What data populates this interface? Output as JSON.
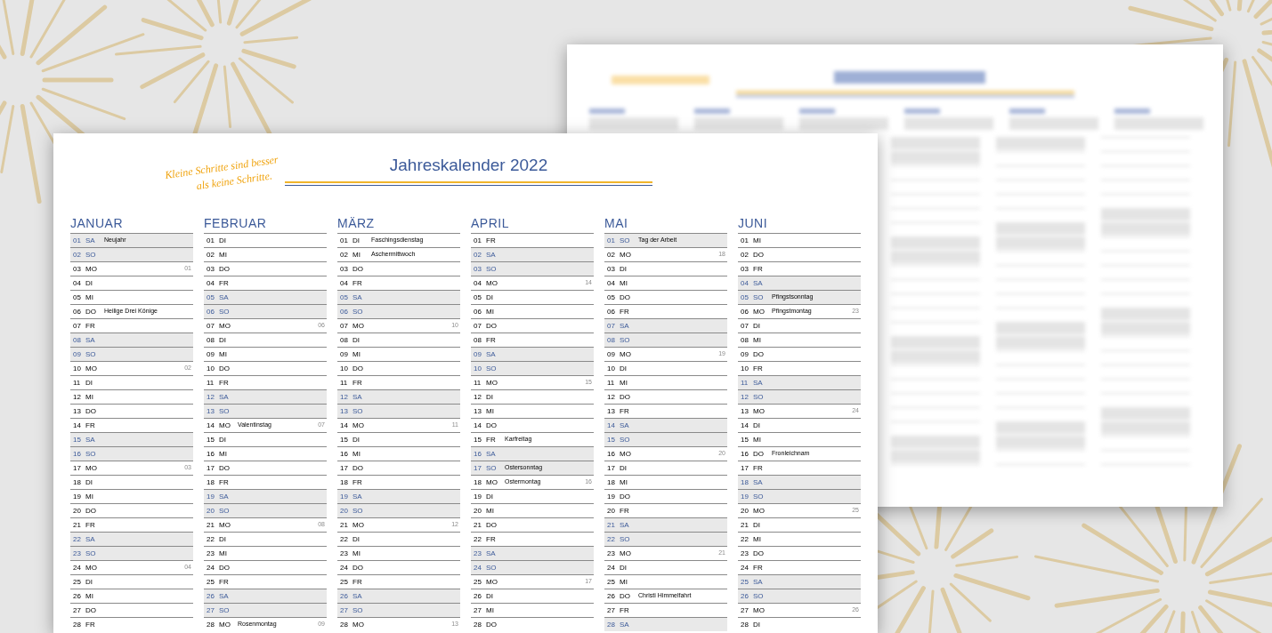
{
  "sheet": {
    "slogan": [
      "Kleine Schritte sind besser",
      "als keine Schritte."
    ],
    "title": "Jahreskalender 2022"
  },
  "months": [
    {
      "name": "JANUAR",
      "days": [
        {
          "date": "01",
          "weekday": "SA",
          "weekend": true,
          "note": "Neujahr"
        },
        {
          "date": "02",
          "weekday": "SO",
          "weekend": true
        },
        {
          "date": "03",
          "weekday": "MO",
          "weekend": false,
          "week": "01"
        },
        {
          "date": "04",
          "weekday": "DI",
          "weekend": false
        },
        {
          "date": "05",
          "weekday": "MI",
          "weekend": false
        },
        {
          "date": "06",
          "weekday": "DO",
          "weekend": false,
          "note": "Heilige Drei Könige"
        },
        {
          "date": "07",
          "weekday": "FR",
          "weekend": false
        },
        {
          "date": "08",
          "weekday": "SA",
          "weekend": true
        },
        {
          "date": "09",
          "weekday": "SO",
          "weekend": true
        },
        {
          "date": "10",
          "weekday": "MO",
          "weekend": false,
          "week": "02"
        },
        {
          "date": "11",
          "weekday": "DI",
          "weekend": false
        },
        {
          "date": "12",
          "weekday": "MI",
          "weekend": false
        },
        {
          "date": "13",
          "weekday": "DO",
          "weekend": false
        },
        {
          "date": "14",
          "weekday": "FR",
          "weekend": false
        },
        {
          "date": "15",
          "weekday": "SA",
          "weekend": true
        },
        {
          "date": "16",
          "weekday": "SO",
          "weekend": true
        },
        {
          "date": "17",
          "weekday": "MO",
          "weekend": false,
          "week": "03"
        },
        {
          "date": "18",
          "weekday": "DI",
          "weekend": false
        },
        {
          "date": "19",
          "weekday": "MI",
          "weekend": false
        },
        {
          "date": "20",
          "weekday": "DO",
          "weekend": false
        },
        {
          "date": "21",
          "weekday": "FR",
          "weekend": false
        },
        {
          "date": "22",
          "weekday": "SA",
          "weekend": true
        },
        {
          "date": "23",
          "weekday": "SO",
          "weekend": true
        },
        {
          "date": "24",
          "weekday": "MO",
          "weekend": false,
          "week": "04"
        },
        {
          "date": "25",
          "weekday": "DI",
          "weekend": false
        },
        {
          "date": "26",
          "weekday": "MI",
          "weekend": false
        },
        {
          "date": "27",
          "weekday": "DO",
          "weekend": false
        },
        {
          "date": "28",
          "weekday": "FR",
          "weekend": false
        }
      ]
    },
    {
      "name": "FEBRUAR",
      "days": [
        {
          "date": "01",
          "weekday": "DI",
          "weekend": false
        },
        {
          "date": "02",
          "weekday": "MI",
          "weekend": false
        },
        {
          "date": "03",
          "weekday": "DO",
          "weekend": false
        },
        {
          "date": "04",
          "weekday": "FR",
          "weekend": false
        },
        {
          "date": "05",
          "weekday": "SA",
          "weekend": true
        },
        {
          "date": "06",
          "weekday": "SO",
          "weekend": true
        },
        {
          "date": "07",
          "weekday": "MO",
          "weekend": false,
          "week": "06"
        },
        {
          "date": "08",
          "weekday": "DI",
          "weekend": false
        },
        {
          "date": "09",
          "weekday": "MI",
          "weekend": false
        },
        {
          "date": "10",
          "weekday": "DO",
          "weekend": false
        },
        {
          "date": "11",
          "weekday": "FR",
          "weekend": false
        },
        {
          "date": "12",
          "weekday": "SA",
          "weekend": true
        },
        {
          "date": "13",
          "weekday": "SO",
          "weekend": true
        },
        {
          "date": "14",
          "weekday": "MO",
          "weekend": false,
          "note": "Valentinstag",
          "week": "07"
        },
        {
          "date": "15",
          "weekday": "DI",
          "weekend": false
        },
        {
          "date": "16",
          "weekday": "MI",
          "weekend": false
        },
        {
          "date": "17",
          "weekday": "DO",
          "weekend": false
        },
        {
          "date": "18",
          "weekday": "FR",
          "weekend": false
        },
        {
          "date": "19",
          "weekday": "SA",
          "weekend": true
        },
        {
          "date": "20",
          "weekday": "SO",
          "weekend": true
        },
        {
          "date": "21",
          "weekday": "MO",
          "weekend": false,
          "week": "08"
        },
        {
          "date": "22",
          "weekday": "DI",
          "weekend": false
        },
        {
          "date": "23",
          "weekday": "MI",
          "weekend": false
        },
        {
          "date": "24",
          "weekday": "DO",
          "weekend": false
        },
        {
          "date": "25",
          "weekday": "FR",
          "weekend": false
        },
        {
          "date": "26",
          "weekday": "SA",
          "weekend": true
        },
        {
          "date": "27",
          "weekday": "SO",
          "weekend": true
        },
        {
          "date": "28",
          "weekday": "MO",
          "weekend": false,
          "note": "Rosenmontag",
          "week": "09"
        }
      ]
    },
    {
      "name": "MÄRZ",
      "days": [
        {
          "date": "01",
          "weekday": "DI",
          "weekend": false,
          "note": "Faschingsdienstag"
        },
        {
          "date": "02",
          "weekday": "MI",
          "weekend": false,
          "note": "Aschermittwoch"
        },
        {
          "date": "03",
          "weekday": "DO",
          "weekend": false
        },
        {
          "date": "04",
          "weekday": "FR",
          "weekend": false
        },
        {
          "date": "05",
          "weekday": "SA",
          "weekend": true
        },
        {
          "date": "06",
          "weekday": "SO",
          "weekend": true
        },
        {
          "date": "07",
          "weekday": "MO",
          "weekend": false,
          "week": "10"
        },
        {
          "date": "08",
          "weekday": "DI",
          "weekend": false
        },
        {
          "date": "09",
          "weekday": "MI",
          "weekend": false
        },
        {
          "date": "10",
          "weekday": "DO",
          "weekend": false
        },
        {
          "date": "11",
          "weekday": "FR",
          "weekend": false
        },
        {
          "date": "12",
          "weekday": "SA",
          "weekend": true
        },
        {
          "date": "13",
          "weekday": "SO",
          "weekend": true
        },
        {
          "date": "14",
          "weekday": "MO",
          "weekend": false,
          "week": "11"
        },
        {
          "date": "15",
          "weekday": "DI",
          "weekend": false
        },
        {
          "date": "16",
          "weekday": "MI",
          "weekend": false
        },
        {
          "date": "17",
          "weekday": "DO",
          "weekend": false
        },
        {
          "date": "18",
          "weekday": "FR",
          "weekend": false
        },
        {
          "date": "19",
          "weekday": "SA",
          "weekend": true
        },
        {
          "date": "20",
          "weekday": "SO",
          "weekend": true
        },
        {
          "date": "21",
          "weekday": "MO",
          "weekend": false,
          "week": "12"
        },
        {
          "date": "22",
          "weekday": "DI",
          "weekend": false
        },
        {
          "date": "23",
          "weekday": "MI",
          "weekend": false
        },
        {
          "date": "24",
          "weekday": "DO",
          "weekend": false
        },
        {
          "date": "25",
          "weekday": "FR",
          "weekend": false
        },
        {
          "date": "26",
          "weekday": "SA",
          "weekend": true
        },
        {
          "date": "27",
          "weekday": "SO",
          "weekend": true
        },
        {
          "date": "28",
          "weekday": "MO",
          "weekend": false,
          "week": "13"
        }
      ]
    },
    {
      "name": "APRIL",
      "days": [
        {
          "date": "01",
          "weekday": "FR",
          "weekend": false
        },
        {
          "date": "02",
          "weekday": "SA",
          "weekend": true
        },
        {
          "date": "03",
          "weekday": "SO",
          "weekend": true
        },
        {
          "date": "04",
          "weekday": "MO",
          "weekend": false,
          "week": "14"
        },
        {
          "date": "05",
          "weekday": "DI",
          "weekend": false
        },
        {
          "date": "06",
          "weekday": "MI",
          "weekend": false
        },
        {
          "date": "07",
          "weekday": "DO",
          "weekend": false
        },
        {
          "date": "08",
          "weekday": "FR",
          "weekend": false
        },
        {
          "date": "09",
          "weekday": "SA",
          "weekend": true
        },
        {
          "date": "10",
          "weekday": "SO",
          "weekend": true
        },
        {
          "date": "11",
          "weekday": "MO",
          "weekend": false,
          "week": "15"
        },
        {
          "date": "12",
          "weekday": "DI",
          "weekend": false
        },
        {
          "date": "13",
          "weekday": "MI",
          "weekend": false
        },
        {
          "date": "14",
          "weekday": "DO",
          "weekend": false
        },
        {
          "date": "15",
          "weekday": "FR",
          "weekend": false,
          "note": "Karfreitag"
        },
        {
          "date": "16",
          "weekday": "SA",
          "weekend": true
        },
        {
          "date": "17",
          "weekday": "SO",
          "weekend": true,
          "note": "Ostersonntag"
        },
        {
          "date": "18",
          "weekday": "MO",
          "weekend": false,
          "note": "Ostermontag",
          "week": "16"
        },
        {
          "date": "19",
          "weekday": "DI",
          "weekend": false
        },
        {
          "date": "20",
          "weekday": "MI",
          "weekend": false
        },
        {
          "date": "21",
          "weekday": "DO",
          "weekend": false
        },
        {
          "date": "22",
          "weekday": "FR",
          "weekend": false
        },
        {
          "date": "23",
          "weekday": "SA",
          "weekend": true
        },
        {
          "date": "24",
          "weekday": "SO",
          "weekend": true
        },
        {
          "date": "25",
          "weekday": "MO",
          "weekend": false,
          "week": "17"
        },
        {
          "date": "26",
          "weekday": "DI",
          "weekend": false
        },
        {
          "date": "27",
          "weekday": "MI",
          "weekend": false
        },
        {
          "date": "28",
          "weekday": "DO",
          "weekend": false
        }
      ]
    },
    {
      "name": "MAI",
      "days": [
        {
          "date": "01",
          "weekday": "SO",
          "weekend": true,
          "note": "Tag der Arbeit"
        },
        {
          "date": "02",
          "weekday": "MO",
          "weekend": false,
          "week": "18"
        },
        {
          "date": "03",
          "weekday": "DI",
          "weekend": false
        },
        {
          "date": "04",
          "weekday": "MI",
          "weekend": false
        },
        {
          "date": "05",
          "weekday": "DO",
          "weekend": false
        },
        {
          "date": "06",
          "weekday": "FR",
          "weekend": false
        },
        {
          "date": "07",
          "weekday": "SA",
          "weekend": true
        },
        {
          "date": "08",
          "weekday": "SO",
          "weekend": true
        },
        {
          "date": "09",
          "weekday": "MO",
          "weekend": false,
          "week": "19"
        },
        {
          "date": "10",
          "weekday": "DI",
          "weekend": false
        },
        {
          "date": "11",
          "weekday": "MI",
          "weekend": false
        },
        {
          "date": "12",
          "weekday": "DO",
          "weekend": false
        },
        {
          "date": "13",
          "weekday": "FR",
          "weekend": false
        },
        {
          "date": "14",
          "weekday": "SA",
          "weekend": true
        },
        {
          "date": "15",
          "weekday": "SO",
          "weekend": true
        },
        {
          "date": "16",
          "weekday": "MO",
          "weekend": false,
          "week": "20"
        },
        {
          "date": "17",
          "weekday": "DI",
          "weekend": false
        },
        {
          "date": "18",
          "weekday": "MI",
          "weekend": false
        },
        {
          "date": "19",
          "weekday": "DO",
          "weekend": false
        },
        {
          "date": "20",
          "weekday": "FR",
          "weekend": false
        },
        {
          "date": "21",
          "weekday": "SA",
          "weekend": true
        },
        {
          "date": "22",
          "weekday": "SO",
          "weekend": true
        },
        {
          "date": "23",
          "weekday": "MO",
          "weekend": false,
          "week": "21"
        },
        {
          "date": "24",
          "weekday": "DI",
          "weekend": false
        },
        {
          "date": "25",
          "weekday": "MI",
          "weekend": false
        },
        {
          "date": "26",
          "weekday": "DO",
          "weekend": false,
          "note": "Christi Himmelfahrt"
        },
        {
          "date": "27",
          "weekday": "FR",
          "weekend": false
        },
        {
          "date": "28",
          "weekday": "SA",
          "weekend": true
        }
      ]
    },
    {
      "name": "JUNI",
      "days": [
        {
          "date": "01",
          "weekday": "MI",
          "weekend": false
        },
        {
          "date": "02",
          "weekday": "DO",
          "weekend": false
        },
        {
          "date": "03",
          "weekday": "FR",
          "weekend": false
        },
        {
          "date": "04",
          "weekday": "SA",
          "weekend": true
        },
        {
          "date": "05",
          "weekday": "SO",
          "weekend": true,
          "note": "Pfingstsonntag"
        },
        {
          "date": "06",
          "weekday": "MO",
          "weekend": false,
          "note": "Pfingstmontag",
          "week": "23"
        },
        {
          "date": "07",
          "weekday": "DI",
          "weekend": false
        },
        {
          "date": "08",
          "weekday": "MI",
          "weekend": false
        },
        {
          "date": "09",
          "weekday": "DO",
          "weekend": false
        },
        {
          "date": "10",
          "weekday": "FR",
          "weekend": false
        },
        {
          "date": "11",
          "weekday": "SA",
          "weekend": true
        },
        {
          "date": "12",
          "weekday": "SO",
          "weekend": true
        },
        {
          "date": "13",
          "weekday": "MO",
          "weekend": false,
          "week": "24"
        },
        {
          "date": "14",
          "weekday": "DI",
          "weekend": false
        },
        {
          "date": "15",
          "weekday": "MI",
          "weekend": false
        },
        {
          "date": "16",
          "weekday": "DO",
          "weekend": false,
          "note": "Fronleichnam"
        },
        {
          "date": "17",
          "weekday": "FR",
          "weekend": false
        },
        {
          "date": "18",
          "weekday": "SA",
          "weekend": true
        },
        {
          "date": "19",
          "weekday": "SO",
          "weekend": true
        },
        {
          "date": "20",
          "weekday": "MO",
          "weekend": false,
          "week": "25"
        },
        {
          "date": "21",
          "weekday": "DI",
          "weekend": false
        },
        {
          "date": "22",
          "weekday": "MI",
          "weekend": false
        },
        {
          "date": "23",
          "weekday": "DO",
          "weekend": false
        },
        {
          "date": "24",
          "weekday": "FR",
          "weekend": false
        },
        {
          "date": "25",
          "weekday": "SA",
          "weekend": true
        },
        {
          "date": "26",
          "weekday": "SO",
          "weekend": true
        },
        {
          "date": "27",
          "weekday": "MO",
          "weekend": false,
          "week": "26"
        },
        {
          "date": "28",
          "weekday": "DI",
          "weekend": false
        }
      ]
    }
  ]
}
